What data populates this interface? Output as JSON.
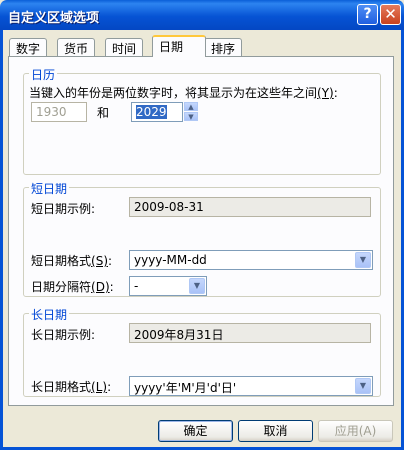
{
  "window": {
    "title": "自定义区域选项",
    "help_label": "?",
    "close_label": "✕"
  },
  "tabs": [
    {
      "label": "数字"
    },
    {
      "label": "货币"
    },
    {
      "label": "时间"
    },
    {
      "label": "日期"
    },
    {
      "label": "排序"
    }
  ],
  "calendar": {
    "group_title": "日历",
    "description": "当键入的年份是两位数字时，将其显示为在这些年之间",
    "description_hotkey": "(Y)",
    "description_colon": ":",
    "from_year": "1930",
    "and_label": "和",
    "to_year": "2029"
  },
  "short_date": {
    "group_title": "短日期",
    "example_label": "短日期示例:",
    "example_value": "2009-08-31",
    "format_label": "短日期格式",
    "format_hotkey": "(S)",
    "format_colon": ":",
    "format_value": "yyyy-MM-dd",
    "separator_label": "日期分隔符",
    "separator_hotkey": "(D)",
    "separator_colon": ":",
    "separator_value": "-"
  },
  "long_date": {
    "group_title": "长日期",
    "example_label": "长日期示例:",
    "example_value": "2009年8月31日",
    "format_label": "长日期格式",
    "format_hotkey": "(L)",
    "format_colon": ":",
    "format_value": "yyyy'年'M'月'd'日'"
  },
  "buttons": {
    "ok": "确定",
    "cancel": "取消",
    "apply": "应用(A)"
  }
}
